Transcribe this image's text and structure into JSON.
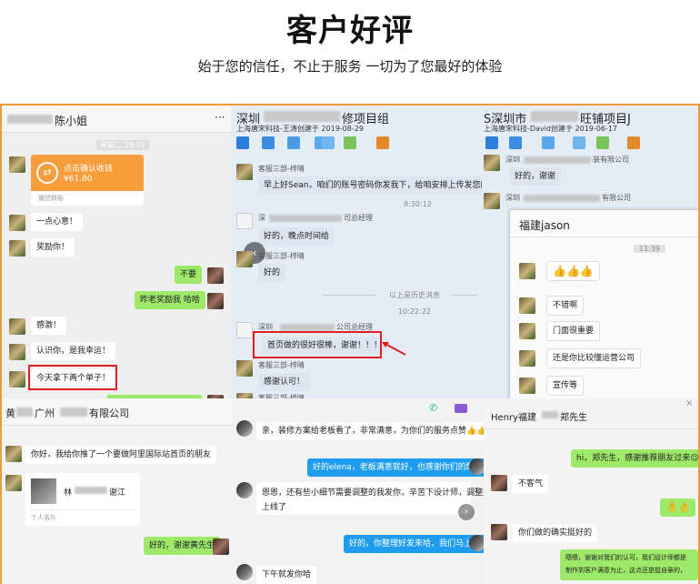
{
  "header": {
    "title": "客户好评",
    "subtitle": "始于您的信任，不止于服务 一切为了您最好的体验"
  },
  "chat1": {
    "title": "陈小姐",
    "menu": "···",
    "time": "星期二 19:29",
    "transfer": {
      "label": "点击确认收钱",
      "amount": "¥61.80",
      "footer": "微信转账"
    },
    "messages": [
      "一点心意！",
      "奖励你！",
      "不要",
      "昨老奖励我 哈哈",
      "感激！",
      "认识你，是我幸运！",
      "今天拿下两个单子！"
    ]
  },
  "chat2": {
    "title": "深圳",
    "title_tail": "修项目组",
    "subtitle": "上海唐宋科技-王涛创建于 2019-08-29",
    "sender1": "客服三部-梓晴",
    "msg1": "早上好Sean，咱们的账号密码你发我下，给咱安排上传发您邮",
    "time1": "8:30:12",
    "sender2": "深",
    "sender2b": "司总经理",
    "msg2": "好的，晚点时间给",
    "sender3": "客服三部-梓晴",
    "msg3": "好的",
    "history": "以上是历史消息",
    "time2": "10:22:22",
    "sender4": "深圳",
    "sender4b": "公司总经理",
    "msg4": "首页做的很好很棒，谢谢！！！",
    "sender5": "客服三部-梓晴",
    "msg5": "感谢认可！",
    "sender6": "客服三部-梓晴"
  },
  "chat3": {
    "title": "S深圳市",
    "title_tail": "旺铺项目J",
    "subtitle": "上海唐宋科技-David创建于 2019-06-17",
    "sender1": "深圳",
    "sender1b": "装有限公司",
    "msg1": "好的，谢谢",
    "sender2": "深圳",
    "sender2b": "有限公司",
    "sub_title": "福建jason",
    "sub_time": "11:39",
    "thumbs": "👍👍👍",
    "messages": [
      "不错啊",
      "门面很重要",
      "还是你比较懂运营公司",
      "宣传等"
    ]
  },
  "chat4": {
    "title_a": "黄",
    "title_b": "广州",
    "title_c": "有限公司",
    "msg1": "你好，我给你推了一个要做阿里国际站首页的朋友",
    "card_name": "林",
    "card_tail": "谢江",
    "card_footer": "个人名片",
    "msg2": "好的，谢谢黄先生"
  },
  "chat5": {
    "msg1": "亲，装修方案给老板看了，非常满意，为你们的服务点赞👍👍👍",
    "msg2": "好的elena，老板满意就好，也感谢你们的配合🌹",
    "msg3a": "恩恩，还有些小细节需要调整的我发你，辛苦下设计师，调整好就可以",
    "msg3b": "上线了",
    "msg4": "好的，你整理好发来哈，我们马上安排🌹",
    "msg5": "下午就发你哈"
  },
  "chat6": {
    "title": "Henry福建",
    "title_tail": "郑先生",
    "close": "×",
    "msg1": "hi，郑先生，感谢推荐朋友过来😉💌",
    "msg2": "不客气",
    "msg3": "👌👌",
    "msg4": "你们做的确实挺好的",
    "msg5a": "嗯嗯，谢谢对我们的认可，我们设计师都是",
    "msg5b": "制作到客户满意为止，这点还是挺自豪的，"
  },
  "colors": {
    "accent": "#f09a3a",
    "wechat_green": "#9ee86a",
    "blue": "#1e9df0",
    "alert_red": "#e02020"
  }
}
